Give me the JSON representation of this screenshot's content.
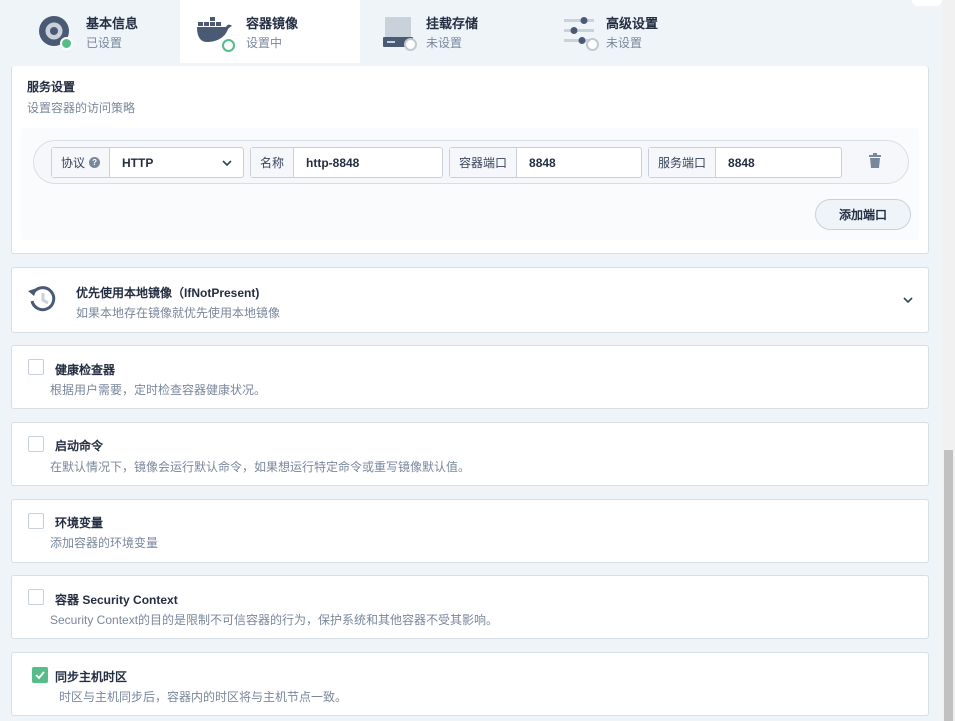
{
  "steps": [
    {
      "title": "基本信息",
      "status": "已设置",
      "icon": "disc-settings-icon"
    },
    {
      "title": "容器镜像",
      "status": "设置中",
      "icon": "docker-whale-icon"
    },
    {
      "title": "挂载存储",
      "status": "未设置",
      "icon": "storage-drive-icon"
    },
    {
      "title": "高级设置",
      "status": "未设置",
      "icon": "sliders-icon"
    }
  ],
  "service": {
    "title": "服务设置",
    "description": "设置容器的访问策略",
    "port": {
      "protocol_label": "协议",
      "protocol_value": "HTTP",
      "name_label": "名称",
      "name_value": "http-8848",
      "container_port_label": "容器端口",
      "container_port_value": "8848",
      "service_port_label": "服务端口",
      "service_port_value": "8848"
    },
    "add_port_label": "添加端口"
  },
  "image_pull": {
    "title": "优先使用本地镜像（IfNotPresent)",
    "description": "如果本地存在镜像就优先使用本地镜像"
  },
  "options": [
    {
      "title": "健康检查器",
      "description": "根据用户需要，定时检查容器健康状况。",
      "checked": false
    },
    {
      "title": "启动命令",
      "description": "在默认情况下，镜像会运行默认命令，如果想运行特定命令或重写镜像默认值。",
      "checked": false
    },
    {
      "title": "环境变量",
      "description": "添加容器的环境变量",
      "checked": false
    },
    {
      "title": "容器 Security Context",
      "description": "Security Context的目的是限制不可信容器的行为，保护系统和其他容器不受其影响。",
      "checked": false
    },
    {
      "title": "同步主机时区",
      "description": "时区与主机同步后，容器内的时区将与主机节点一致。",
      "checked": true
    }
  ],
  "colors": {
    "accent_green": "#55bc8a",
    "text_dark": "#242e42",
    "text_muted": "#79879c",
    "page_bg": "#eff4f9"
  }
}
